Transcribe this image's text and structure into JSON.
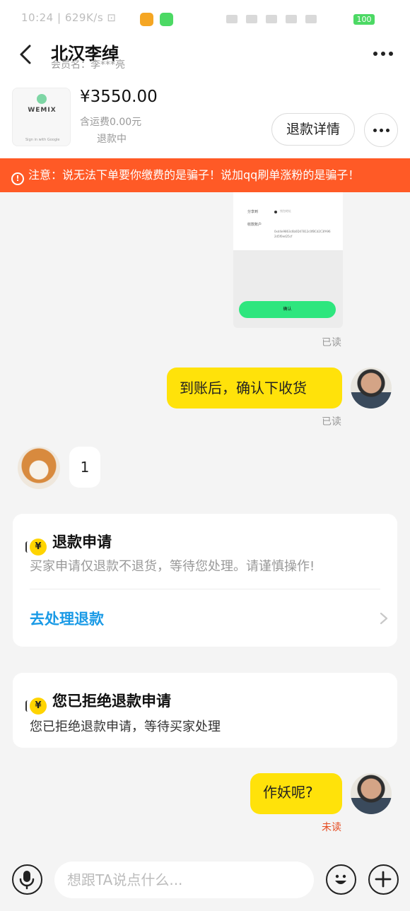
{
  "status_bar": {
    "time": "10:24 | 629K/s ⊡"
  },
  "header": {
    "title": "北汉李绰",
    "member": "会员名：李***亮"
  },
  "product": {
    "thumb_logo": "WEMIX",
    "thumb_footer": "Sign in with Google",
    "price": "¥3550.00",
    "shipping": "含运费0.00元",
    "status": "退款中",
    "refund_details_label": "退款详情"
  },
  "warning": {
    "text": "注意：说无法下单要你缴费的是骗子！说加qq刷单涨粉的是骗子！"
  },
  "shot": {
    "label1": "分享到",
    "label2": "钱包地址",
    "label3": "收款账户",
    "address": "0xd4e9863c6b0D47812c0fBCd2C3fA962d5f0ed25cf",
    "button": "确认"
  },
  "messages": {
    "read_1": "已读",
    "me_1": "到账后，确认下收货",
    "read_2": "已读",
    "other_1": "1",
    "me_2": "作妖呢?",
    "unread": "未读"
  },
  "cards": {
    "refund_request": {
      "icon": "¥",
      "title": "退款申请",
      "desc": "买家申请仅退款不退货，等待您处理。请谨慎操作!",
      "link": "去处理退款"
    },
    "refund_rejected": {
      "icon": "¥",
      "title": "您已拒绝退款申请",
      "desc": "您已拒绝退款申请，等待买家处理"
    }
  },
  "input": {
    "placeholder": "想跟TA说点什么...",
    "value": ""
  },
  "colors": {
    "accent_yellow": "#ffe20a",
    "warning_orange": "#ff5a26",
    "link_blue": "#1a9ae6",
    "unread_red": "#e54a1f"
  },
  "icons": [
    "back-icon",
    "more-icon",
    "warning-icon",
    "refund-yuan-icon",
    "chevron-right-icon",
    "microphone-icon",
    "emoji-icon",
    "plus-icon"
  ]
}
